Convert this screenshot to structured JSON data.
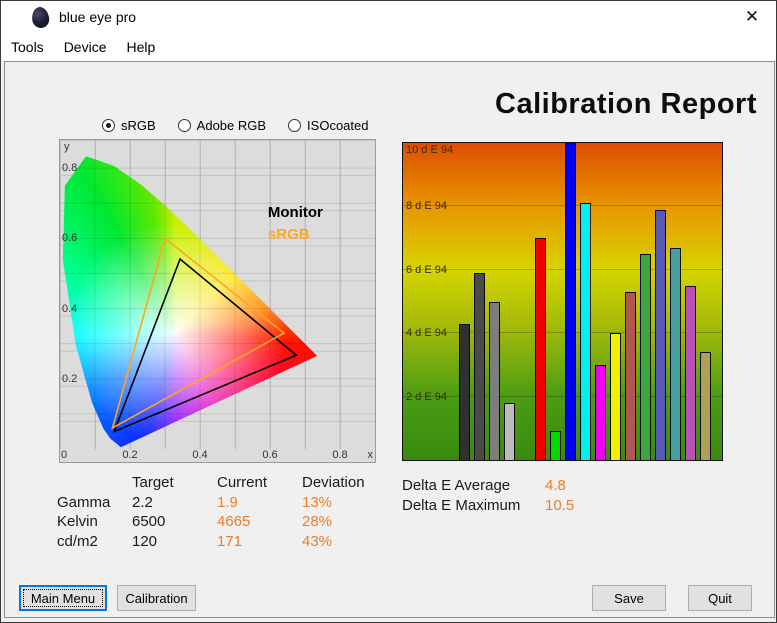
{
  "window": {
    "title": "blue eye pro",
    "close": "✕"
  },
  "menu": {
    "items": [
      "Tools",
      "Device",
      "Help"
    ]
  },
  "profiles": [
    {
      "label": "sRGB",
      "selected": true
    },
    {
      "label": "Adobe RGB",
      "selected": false
    },
    {
      "label": "ISOcoated",
      "selected": false
    }
  ],
  "report_title": "Calibration Report",
  "chart_data": [
    {
      "type": "scatter",
      "name": "cie-chromaticity-gamut-diagram",
      "xlabel": "x",
      "ylabel": "y",
      "xlim": [
        0,
        0.9
      ],
      "ylim": [
        0,
        0.88
      ],
      "x_ticks": [
        "0",
        "0.2",
        "0.4",
        "0.6",
        "0.8"
      ],
      "x_tick_values": [
        0,
        0.2,
        0.4,
        0.6,
        0.8
      ],
      "y_ticks": [
        "0.2",
        "0.4",
        "0.6",
        "0.8"
      ],
      "y_tick_values": [
        0.2,
        0.4,
        0.6,
        0.8
      ],
      "grid": true,
      "grid_step": 0.1,
      "legend": [
        {
          "label": "Monitor",
          "color": "#000000"
        },
        {
          "label": "sRGB",
          "color": "#ffa521"
        }
      ],
      "series": [
        {
          "name": "Monitor",
          "color": "#000000",
          "points": [
            [
              0.675,
              0.267
            ],
            [
              0.343,
              0.541
            ],
            [
              0.155,
              0.05
            ]
          ]
        },
        {
          "name": "sRGB",
          "color": "#ffa521",
          "points": [
            [
              0.64,
              0.33
            ],
            [
              0.3,
              0.6
            ],
            [
              0.15,
              0.06
            ]
          ]
        }
      ],
      "locus": [
        [
          0.1741,
          0.005
        ],
        [
          0.144,
          0.0297
        ],
        [
          0.1241,
          0.0578
        ],
        [
          0.0913,
          0.1327
        ],
        [
          0.0454,
          0.295
        ],
        [
          0.0082,
          0.5384
        ],
        [
          0.0139,
          0.7502
        ],
        [
          0.0743,
          0.8338
        ],
        [
          0.1547,
          0.8059
        ],
        [
          0.2296,
          0.7543
        ],
        [
          0.3016,
          0.6923
        ],
        [
          0.3731,
          0.6245
        ],
        [
          0.4441,
          0.5547
        ],
        [
          0.5125,
          0.4866
        ],
        [
          0.5752,
          0.4242
        ],
        [
          0.627,
          0.3725
        ],
        [
          0.6915,
          0.3083
        ],
        [
          0.7347,
          0.2653
        ]
      ]
    },
    {
      "type": "bar",
      "name": "delta-e94-per-patch",
      "ylim": [
        0,
        10
      ],
      "y_ticks": [
        "2 d E 94",
        "4 d E 94",
        "6 d E 94",
        "8 d E 94",
        "10 d E 94"
      ],
      "y_tick_values": [
        2,
        4,
        6,
        8,
        10
      ],
      "values": [
        4.3,
        5.9,
        5.0,
        1.8,
        7.0,
        0.9,
        10.5,
        8.1,
        3.0,
        4.0,
        5.3,
        6.5,
        7.9,
        6.7,
        5.5,
        3.4
      ],
      "colors": [
        "#303030",
        "#4a4a4a",
        "#7d7d7d",
        "#bdbdbd",
        "#f00000",
        "#00d800",
        "#0000f0",
        "#00f0f0",
        "#f000f0",
        "#f0f000",
        "#b25555",
        "#3da53d",
        "#5858b8",
        "#46a0a0",
        "#b852b8",
        "#afa057"
      ],
      "background_gradient": [
        "#3a8a10",
        "#4c9c14",
        "#9cb80a",
        "#d6d400",
        "#e89600",
        "#dd4e02"
      ]
    }
  ],
  "measurements": {
    "headers": [
      "",
      "Target",
      "Current",
      "Deviation"
    ],
    "rows": [
      {
        "label": "Gamma",
        "target": "2.2",
        "current": "1.9",
        "deviation": "13%"
      },
      {
        "label": "Kelvin",
        "target": "6500",
        "current": "4665",
        "deviation": "28%"
      },
      {
        "label": "cd/m2",
        "target": "120",
        "current": "171",
        "deviation": "43%"
      }
    ]
  },
  "delta_e": {
    "average_label": "Delta E Average",
    "average": "4.8",
    "maximum_label": "Delta E Maximum",
    "maximum": "10.5"
  },
  "buttons": {
    "main_menu": "Main Menu",
    "calibration": "Calibration",
    "save": "Save",
    "quit": "Quit"
  },
  "colors": {
    "accent_orange": "#ee7c28",
    "focus_blue": "#0078d7",
    "srgb_orange": "#ffa521"
  }
}
